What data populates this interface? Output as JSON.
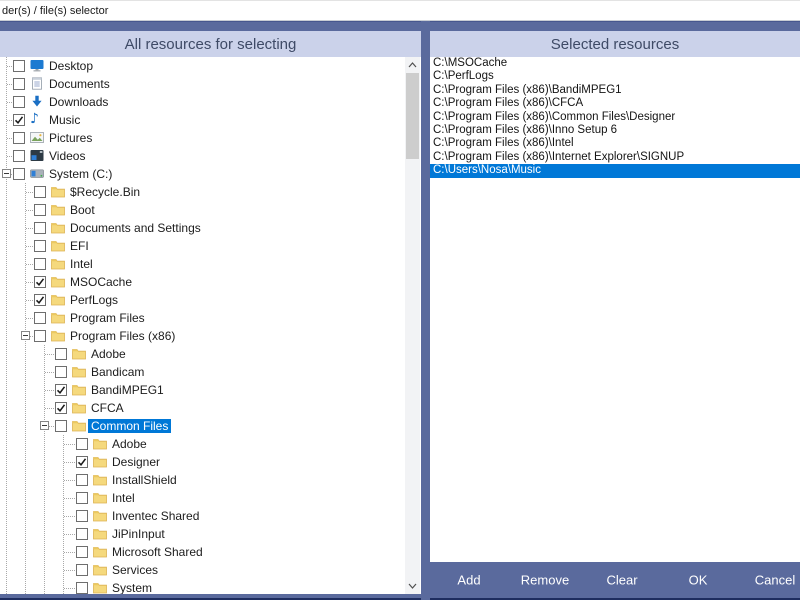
{
  "window": {
    "title": "der(s) / file(s) selector"
  },
  "left_panel": {
    "header": "All resources for selecting",
    "tree": [
      {
        "label": "Desktop",
        "level": 0,
        "icon": "desktop",
        "checked": false,
        "expander": false,
        "selected": false
      },
      {
        "label": "Documents",
        "level": 0,
        "icon": "documents",
        "checked": false,
        "expander": false,
        "selected": false
      },
      {
        "label": "Downloads",
        "level": 0,
        "icon": "downloads",
        "checked": false,
        "expander": false,
        "selected": false
      },
      {
        "label": "Music",
        "level": 0,
        "icon": "music",
        "checked": true,
        "expander": false,
        "selected": false
      },
      {
        "label": "Pictures",
        "level": 0,
        "icon": "pictures",
        "checked": false,
        "expander": false,
        "selected": false
      },
      {
        "label": "Videos",
        "level": 0,
        "icon": "videos",
        "checked": false,
        "expander": false,
        "selected": false
      },
      {
        "label": "System (C:)",
        "level": 0,
        "icon": "drive",
        "checked": false,
        "expander": true,
        "selected": false
      },
      {
        "label": "$Recycle.Bin",
        "level": 1,
        "icon": "folder",
        "checked": false,
        "expander": false,
        "selected": false
      },
      {
        "label": "Boot",
        "level": 1,
        "icon": "folder",
        "checked": false,
        "expander": false,
        "selected": false
      },
      {
        "label": "Documents and Settings",
        "level": 1,
        "icon": "folder",
        "checked": false,
        "expander": false,
        "selected": false
      },
      {
        "label": "EFI",
        "level": 1,
        "icon": "folder",
        "checked": false,
        "expander": false,
        "selected": false
      },
      {
        "label": "Intel",
        "level": 1,
        "icon": "folder",
        "checked": false,
        "expander": false,
        "selected": false
      },
      {
        "label": "MSOCache",
        "level": 1,
        "icon": "folder",
        "checked": true,
        "expander": false,
        "selected": false
      },
      {
        "label": "PerfLogs",
        "level": 1,
        "icon": "folder",
        "checked": true,
        "expander": false,
        "selected": false
      },
      {
        "label": "Program Files",
        "level": 1,
        "icon": "folder",
        "checked": false,
        "expander": false,
        "selected": false
      },
      {
        "label": "Program Files (x86)",
        "level": 1,
        "icon": "folder",
        "checked": false,
        "expander": true,
        "selected": false
      },
      {
        "label": "Adobe",
        "level": 2,
        "icon": "folder",
        "checked": false,
        "expander": false,
        "selected": false
      },
      {
        "label": "Bandicam",
        "level": 2,
        "icon": "folder",
        "checked": false,
        "expander": false,
        "selected": false
      },
      {
        "label": "BandiMPEG1",
        "level": 2,
        "icon": "folder",
        "checked": true,
        "expander": false,
        "selected": false
      },
      {
        "label": "CFCA",
        "level": 2,
        "icon": "folder",
        "checked": true,
        "expander": false,
        "selected": false
      },
      {
        "label": "Common Files",
        "level": 2,
        "icon": "folder",
        "checked": false,
        "expander": true,
        "selected": true
      },
      {
        "label": "Adobe",
        "level": 3,
        "icon": "folder",
        "checked": false,
        "expander": false,
        "selected": false
      },
      {
        "label": "Designer",
        "level": 3,
        "icon": "folder",
        "checked": true,
        "expander": false,
        "selected": false
      },
      {
        "label": "InstallShield",
        "level": 3,
        "icon": "folder",
        "checked": false,
        "expander": false,
        "selected": false
      },
      {
        "label": "Intel",
        "level": 3,
        "icon": "folder",
        "checked": false,
        "expander": false,
        "selected": false
      },
      {
        "label": "Inventec Shared",
        "level": 3,
        "icon": "folder",
        "checked": false,
        "expander": false,
        "selected": false
      },
      {
        "label": "JiPinInput",
        "level": 3,
        "icon": "folder",
        "checked": false,
        "expander": false,
        "selected": false
      },
      {
        "label": "Microsoft Shared",
        "level": 3,
        "icon": "folder",
        "checked": false,
        "expander": false,
        "selected": false
      },
      {
        "label": "Services",
        "level": 3,
        "icon": "folder",
        "checked": false,
        "expander": false,
        "selected": false
      },
      {
        "label": "System",
        "level": 3,
        "icon": "folder",
        "checked": false,
        "expander": false,
        "selected": false
      }
    ]
  },
  "right_panel": {
    "header": "Selected resources",
    "paths": [
      "C:\\MSOCache",
      "C:\\PerfLogs",
      "C:\\Program Files (x86)\\BandiMPEG1",
      "C:\\Program Files (x86)\\CFCA",
      "C:\\Program Files (x86)\\Common Files\\Designer",
      "C:\\Program Files (x86)\\Inno Setup 6",
      "C:\\Program Files (x86)\\Intel",
      "C:\\Program Files (x86)\\Internet Explorer\\SIGNUP",
      "C:\\Users\\Nosa\\Music"
    ],
    "selected_index": 8
  },
  "buttons": [
    {
      "label": "Add"
    },
    {
      "label": "Remove"
    },
    {
      "label": "Clear"
    },
    {
      "label": "OK"
    },
    {
      "label": "Cancel"
    }
  ],
  "colors": {
    "frame": "#5a6a9d",
    "header_bg": "#cbd2ea",
    "header_text": "#3e4a66",
    "selection": "#0078d7",
    "folder": "#f5d97d",
    "bottom_line": "#1e2d5f"
  }
}
